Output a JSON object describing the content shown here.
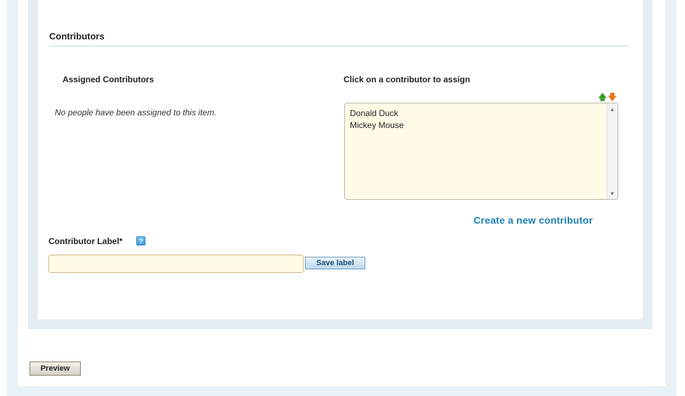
{
  "section": {
    "title": "Contributors"
  },
  "assigned": {
    "heading": "Assigned Contributors",
    "empty_message": "No people have been assigned to this item."
  },
  "available": {
    "heading": "Click on a contributor to assign",
    "items": [
      "Donald Duck",
      "Mickey Mouse"
    ],
    "move_up_icon": "arrow-up-icon",
    "move_down_icon": "arrow-down-icon"
  },
  "create_link": "Create a new contributor",
  "label_field": {
    "title": "Contributor Label*",
    "help_icon": "info-icon",
    "help_glyph": "?",
    "value": "",
    "placeholder": "",
    "save_button": "Save label"
  },
  "footer": {
    "preview_button": "Preview"
  },
  "colors": {
    "link": "#1a7fb8",
    "input_background": "#fffbe6",
    "panel_frame": "#e4edf2"
  }
}
